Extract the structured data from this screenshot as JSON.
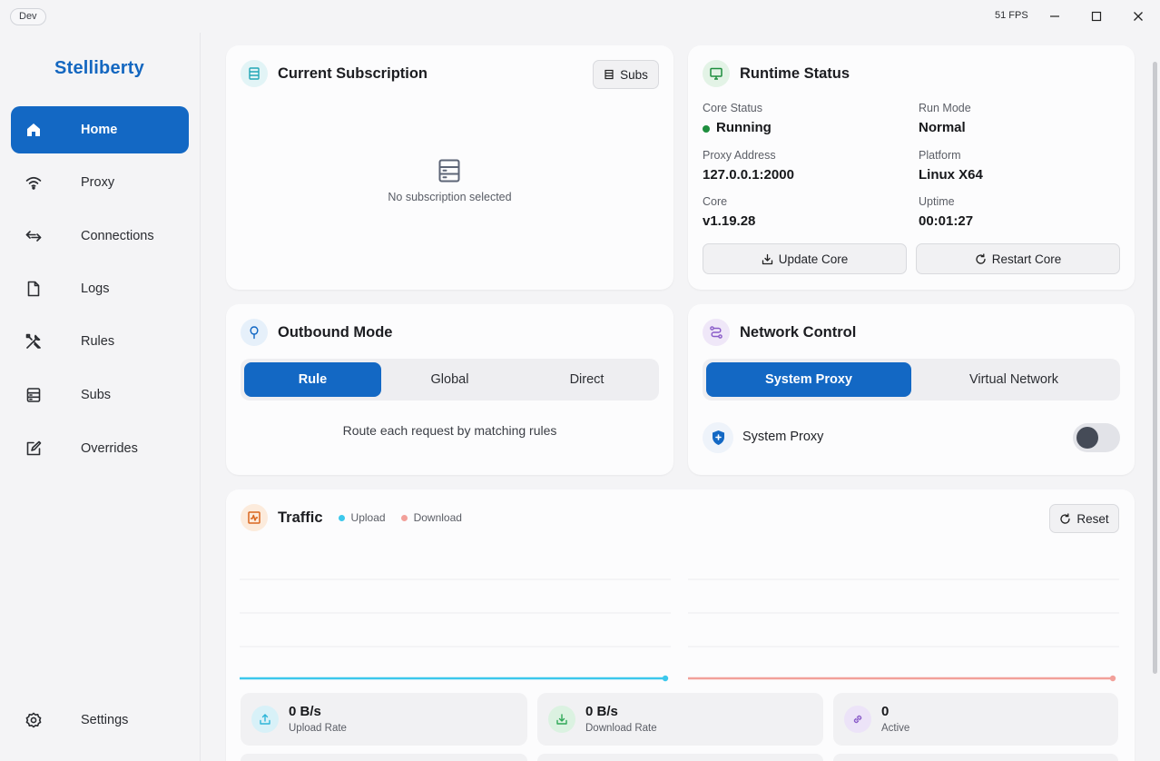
{
  "titlebar": {
    "badge": "Dev",
    "fps": "51 FPS"
  },
  "sidebar": {
    "brand": "Stelliberty",
    "items": [
      {
        "label": "Home",
        "icon": "home-icon",
        "active": true
      },
      {
        "label": "Proxy",
        "icon": "wifi-icon"
      },
      {
        "label": "Connections",
        "icon": "arrows-exchange-icon"
      },
      {
        "label": "Logs",
        "icon": "document-icon"
      },
      {
        "label": "Rules",
        "icon": "tools-icon"
      },
      {
        "label": "Subs",
        "icon": "server-list-icon"
      },
      {
        "label": "Overrides",
        "icon": "edit-square-icon"
      }
    ],
    "settings": "Settings"
  },
  "subscription": {
    "title": "Current Subscription",
    "subs_button": "Subs",
    "empty_text": "No subscription selected"
  },
  "runtime": {
    "title": "Runtime Status",
    "core_status_label": "Core Status",
    "core_status_value": "Running",
    "run_mode_label": "Run Mode",
    "run_mode_value": "Normal",
    "proxy_address_label": "Proxy Address",
    "proxy_address_value": "127.0.0.1:2000",
    "platform_label": "Platform",
    "platform_value": "Linux X64",
    "core_label": "Core",
    "core_value": "v1.19.28",
    "uptime_label": "Uptime",
    "uptime_value": "00:01:27",
    "update_button": "Update Core",
    "restart_button": "Restart Core",
    "status_color": "#1e8e3e"
  },
  "outbound": {
    "title": "Outbound Mode",
    "options": [
      "Rule",
      "Global",
      "Direct"
    ],
    "selected": "Rule",
    "description": "Route each request by matching rules"
  },
  "network": {
    "title": "Network Control",
    "options": [
      "System Proxy",
      "Virtual Network"
    ],
    "selected": "System Proxy",
    "toggle_label": "System Proxy",
    "toggle_on": false
  },
  "traffic": {
    "title": "Traffic",
    "legend_upload": "Upload",
    "legend_download": "Download",
    "reset_button": "Reset",
    "upload_color": "#3cc8ec",
    "download_color": "#f2a09a",
    "upload_rate_value": "0 B/s",
    "upload_rate_label": "Upload Rate",
    "download_rate_value": "0 B/s",
    "download_rate_label": "Download Rate",
    "active_value": "0",
    "active_label": "Active"
  },
  "colors": {
    "accent": "#1368c4"
  }
}
